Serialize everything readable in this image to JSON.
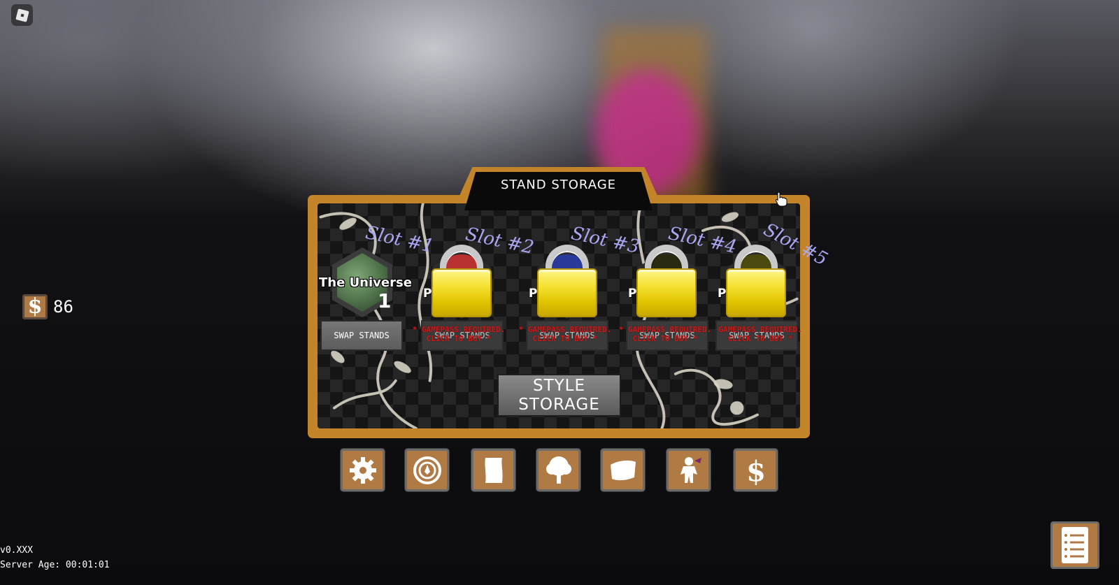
{
  "hud": {
    "money": "86",
    "version": "v0.XXX",
    "server_age": "Server Age: 00:01:01"
  },
  "panel": {
    "title": "STAND STORAGE",
    "slots": [
      {
        "label": "Slot #1",
        "stand_name": "The Universe",
        "stand_number": "1",
        "button": "SWAP STANDS",
        "locked": false
      },
      {
        "label": "Slot #2",
        "premium": "P M",
        "button": "SWAP STANDS",
        "gamepass_line1": "* GAMEPASS REQUIRED.",
        "gamepass_line2": "CLICK TO BUY *",
        "locked": true
      },
      {
        "label": "Slot #3",
        "premium": "P M",
        "button": "SWAP STANDS",
        "gamepass_line1": "* GAMEPASS REQUIRED.",
        "gamepass_line2": "CLICK TO BUY *",
        "locked": true
      },
      {
        "label": "Slot #4",
        "premium": "P M",
        "button": "SWAP STANDS",
        "gamepass_line1": "* GAMEPASS REQUIRED.",
        "gamepass_line2": "CLICK TO BUY *",
        "locked": true
      },
      {
        "label": "Slot #5",
        "premium": "P M",
        "button": "SWAP STANDS",
        "gamepass_line1": "GAMEPASS REQUIRED.",
        "gamepass_line2": "CLICK TO BUY *",
        "locked": true
      }
    ],
    "style_button": "STYLE\nSTORAGE"
  },
  "toolbar": [
    {
      "icon": "gear-icon"
    },
    {
      "icon": "stat-wheel-icon"
    },
    {
      "icon": "scroll-icon"
    },
    {
      "icon": "tree-icon"
    },
    {
      "icon": "cloth-icon"
    },
    {
      "icon": "stand-figure-icon"
    },
    {
      "icon": "dollar-icon"
    }
  ],
  "colors": {
    "frame": "#c4852a",
    "slot_label": "#a9a6f2",
    "gamepass": "#d01818",
    "lock_yellow": "#f5e232",
    "button_brown": "#b07a44"
  }
}
